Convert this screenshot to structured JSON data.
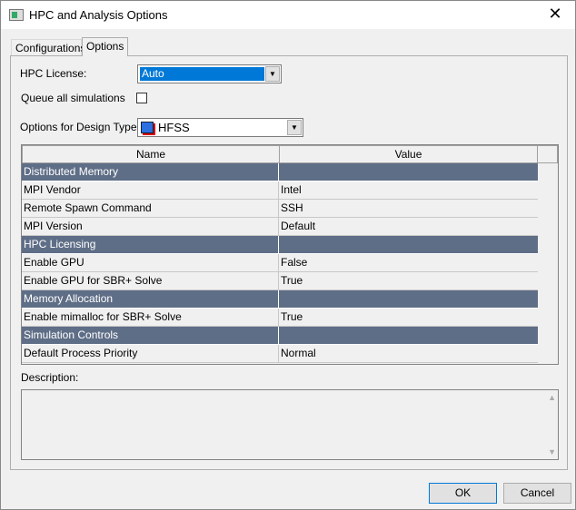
{
  "window": {
    "title": "HPC and Analysis Options",
    "close": "✕"
  },
  "tabs": [
    {
      "label": "Configurations"
    },
    {
      "label": "Options",
      "active": true
    }
  ],
  "options": {
    "hpc_license_label": "HPC License:",
    "hpc_license_value": "Auto",
    "queue_label": "Queue all simulations",
    "queue_checked": false,
    "design_type_label": "Options for Design Type:",
    "design_type_value": "HFSS"
  },
  "grid": {
    "headers": [
      "Name",
      "Value"
    ],
    "rows": [
      {
        "name": "Distributed Memory",
        "value": "",
        "category": true
      },
      {
        "name": "MPI Vendor",
        "value": "Intel"
      },
      {
        "name": "Remote Spawn Command",
        "value": "SSH"
      },
      {
        "name": "MPI Version",
        "value": "Default"
      },
      {
        "name": "HPC Licensing",
        "value": "",
        "category": true
      },
      {
        "name": "Enable GPU",
        "value": "False"
      },
      {
        "name": "Enable GPU for SBR+ Solve",
        "value": "True"
      },
      {
        "name": "Memory Allocation",
        "value": "",
        "category": true
      },
      {
        "name": "Enable mimalloc for SBR+ Solve",
        "value": "True"
      },
      {
        "name": "Simulation Controls",
        "value": "",
        "category": true
      },
      {
        "name": "Default Process Priority",
        "value": "Normal"
      }
    ]
  },
  "description": {
    "label": "Description:",
    "text": ""
  },
  "buttons": {
    "ok": "OK",
    "cancel": "Cancel"
  },
  "colors": {
    "category_bg": "#5f6e87",
    "selection": "#0078d7"
  }
}
